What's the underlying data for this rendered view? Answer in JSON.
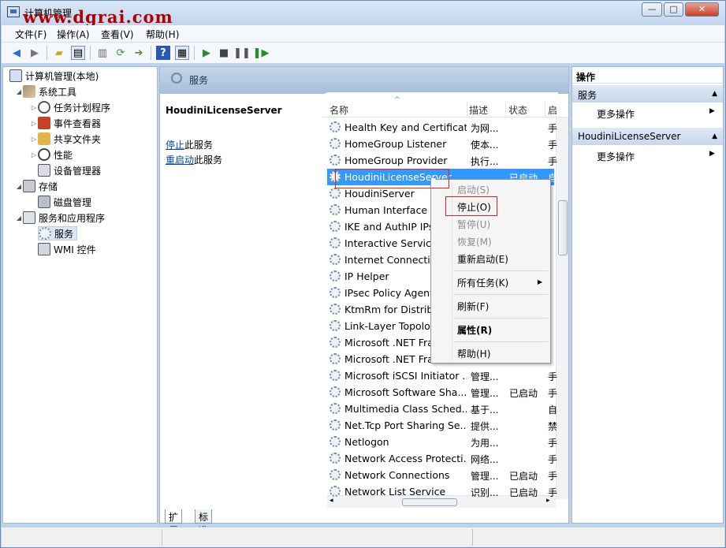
{
  "window": {
    "title": "计算机管理",
    "watermark": "www.dgrai.com",
    "buttons": {
      "minimize": "—",
      "maximize": "□",
      "close": "✕"
    }
  },
  "menu": [
    "文件(F)",
    "操作(A)",
    "查看(V)",
    "帮助(H)"
  ],
  "toolbar": {
    "icons": [
      "back-icon",
      "forward-icon",
      "up-folder-icon",
      "show-hide-tree-icon",
      "export-icon",
      "refresh-icon",
      "export-list-icon",
      "help-icon",
      "properties-icon",
      "play-icon",
      "stop-icon",
      "pause-icon",
      "restart-icon"
    ]
  },
  "tree": [
    {
      "label": "计算机管理(本地)",
      "level": 0,
      "icon": "computer-icon"
    },
    {
      "label": "系统工具",
      "level": 1,
      "icon": "tools-icon",
      "expanded": true
    },
    {
      "label": "任务计划程序",
      "level": 2,
      "icon": "clock-icon"
    },
    {
      "label": "事件查看器",
      "level": 2,
      "icon": "event-viewer-icon"
    },
    {
      "label": "共享文件夹",
      "level": 2,
      "icon": "shared-folder-icon"
    },
    {
      "label": "性能",
      "level": 2,
      "icon": "performance-icon"
    },
    {
      "label": "设备管理器",
      "level": 2,
      "icon": "device-manager-icon"
    },
    {
      "label": "存储",
      "level": 1,
      "icon": "storage-icon",
      "expanded": true
    },
    {
      "label": "磁盘管理",
      "level": 2,
      "icon": "disk-icon"
    },
    {
      "label": "服务和应用程序",
      "level": 1,
      "icon": "services-apps-icon",
      "expanded": true
    },
    {
      "label": "服务",
      "level": 2,
      "icon": "services-gear-icon",
      "selected": true
    },
    {
      "label": "WMI 控件",
      "level": 2,
      "icon": "wmi-icon"
    }
  ],
  "center": {
    "header_title": "服务",
    "selected_service": "HoudiniLicenseServer",
    "stop_link": "停止",
    "stop_suffix": "此服务",
    "restart_link": "重启动",
    "restart_suffix": "此服务",
    "columns": {
      "name": "名称",
      "desc": "描述",
      "status": "状态",
      "startup": "启"
    },
    "services": [
      {
        "name": "Health Key and Certificat...",
        "desc": "为网...",
        "status": "",
        "startup": "手"
      },
      {
        "name": "HomeGroup Listener",
        "desc": "使本...",
        "status": "",
        "startup": "手"
      },
      {
        "name": "HomeGroup Provider",
        "desc": "执行...",
        "status": "",
        "startup": "手"
      },
      {
        "name": "HoudiniLicenseServer",
        "desc": "",
        "status": "已启动",
        "startup": "自",
        "selected": true
      },
      {
        "name": "HoudiniServer",
        "desc": "",
        "status": "",
        "startup": ""
      },
      {
        "name": "Human Interface Dev...",
        "desc": "",
        "status": "",
        "startup": ""
      },
      {
        "name": "IKE and AuthIP IPsec...",
        "desc": "",
        "status": "",
        "startup": ""
      },
      {
        "name": "Interactive Services...",
        "desc": "",
        "status": "",
        "startup": ""
      },
      {
        "name": "Internet Connection...",
        "desc": "",
        "status": "",
        "startup": ""
      },
      {
        "name": "IP Helper",
        "desc": "",
        "status": "",
        "startup": ""
      },
      {
        "name": "IPsec Policy Agent",
        "desc": "",
        "status": "",
        "startup": ""
      },
      {
        "name": "KtmRm for Distribu...",
        "desc": "",
        "status": "",
        "startup": ""
      },
      {
        "name": "Link-Layer Topology...",
        "desc": "",
        "status": "",
        "startup": ""
      },
      {
        "name": "Microsoft .NET Fram...",
        "desc": "",
        "status": "",
        "startup": ""
      },
      {
        "name": "Microsoft .NET Fram...",
        "desc": "",
        "status": "",
        "startup": ""
      },
      {
        "name": "Microsoft iSCSI Initiator ...",
        "desc": "管理...",
        "status": "",
        "startup": "手"
      },
      {
        "name": "Microsoft Software Sha...",
        "desc": "管理...",
        "status": "已启动",
        "startup": "手"
      },
      {
        "name": "Multimedia Class Sched...",
        "desc": "基于...",
        "status": "",
        "startup": "自"
      },
      {
        "name": "Net.Tcp Port Sharing Se...",
        "desc": "提供...",
        "status": "",
        "startup": "禁"
      },
      {
        "name": "Netlogon",
        "desc": "为用...",
        "status": "",
        "startup": "手"
      },
      {
        "name": "Network Access Protecti...",
        "desc": "网络...",
        "status": "",
        "startup": "手"
      },
      {
        "name": "Network Connections",
        "desc": "管理...",
        "status": "已启动",
        "startup": "手"
      },
      {
        "name": "Network List Service",
        "desc": "识别...",
        "status": "已启动",
        "startup": "手"
      }
    ],
    "tabs": [
      "扩展",
      "标准"
    ]
  },
  "context_menu": [
    {
      "label": "启动(S)",
      "disabled": true
    },
    {
      "label": "停止(O)",
      "disabled": false,
      "highlighted": true
    },
    {
      "label": "暂停(U)",
      "disabled": true
    },
    {
      "label": "恢复(M)",
      "disabled": true
    },
    {
      "label": "重新启动(E)",
      "disabled": false
    },
    {
      "label": "所有任务(K)",
      "disabled": false,
      "submenu": true
    },
    {
      "label": "刷新(F)",
      "disabled": false
    },
    {
      "label": "属性(R)",
      "disabled": false,
      "bold": true
    },
    {
      "label": "帮助(H)",
      "disabled": false
    }
  ],
  "actions": {
    "title": "操作",
    "sections": [
      {
        "label": "服务",
        "item": "更多操作"
      },
      {
        "label": "HoudiniLicenseServer",
        "item": "更多操作"
      }
    ]
  },
  "colors": {
    "selection": "#3399ff",
    "highlight_box": "#dd2222",
    "watermark": "#b00000"
  }
}
